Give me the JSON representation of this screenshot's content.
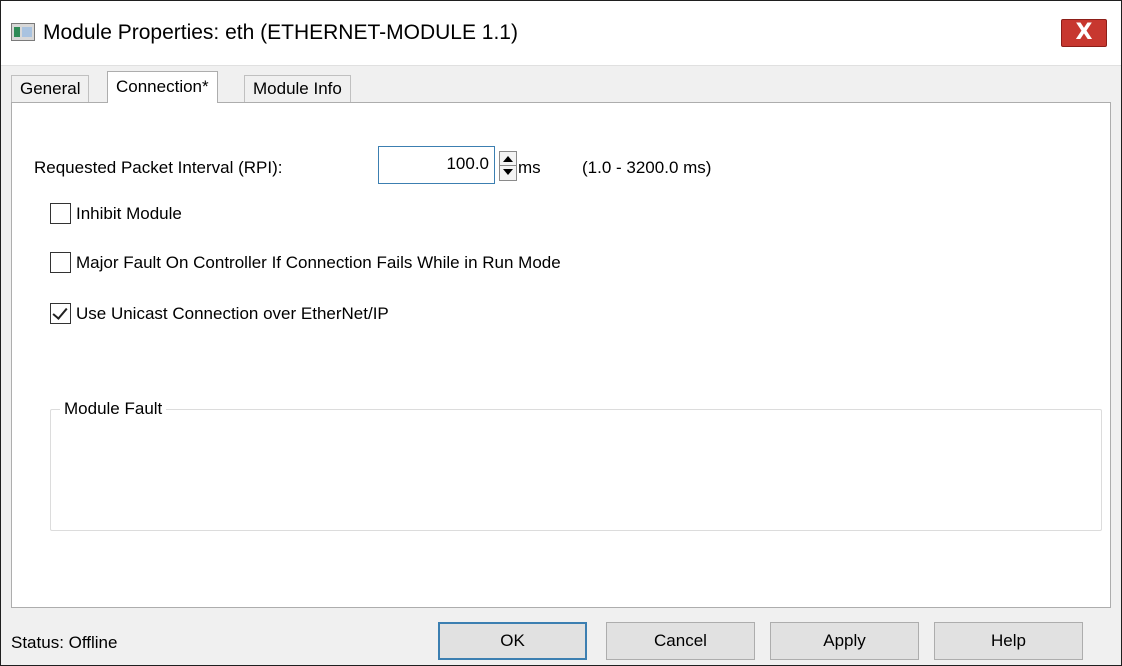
{
  "window": {
    "title": "Module Properties: eth (ETHERNET-MODULE 1.1)",
    "close_glyph": "X",
    "icon": "module-window-icon"
  },
  "tabs": [
    {
      "label": "General",
      "active": false
    },
    {
      "label": "Connection*",
      "active": true
    },
    {
      "label": "Module Info",
      "active": false
    }
  ],
  "connection": {
    "rpi_label": "Requested Packet Interval (RPI):",
    "rpi_value": "100.0",
    "rpi_unit": "ms",
    "rpi_range": "(1.0 - 3200.0 ms)",
    "inhibit_label": "Inhibit Module",
    "inhibit_checked": false,
    "major_fault_label": "Major Fault On Controller If Connection Fails While in Run Mode",
    "major_fault_checked": false,
    "unicast_label": "Use Unicast Connection over EtherNet/IP",
    "unicast_checked": true,
    "module_fault_title": "Module Fault"
  },
  "status": {
    "text": "Status:  Offline"
  },
  "buttons": {
    "ok": "OK",
    "cancel": "Cancel",
    "apply": "Apply",
    "help": "Help"
  },
  "colors": {
    "close_button": "#c7372f",
    "focus_border": "#3c7fb1"
  }
}
